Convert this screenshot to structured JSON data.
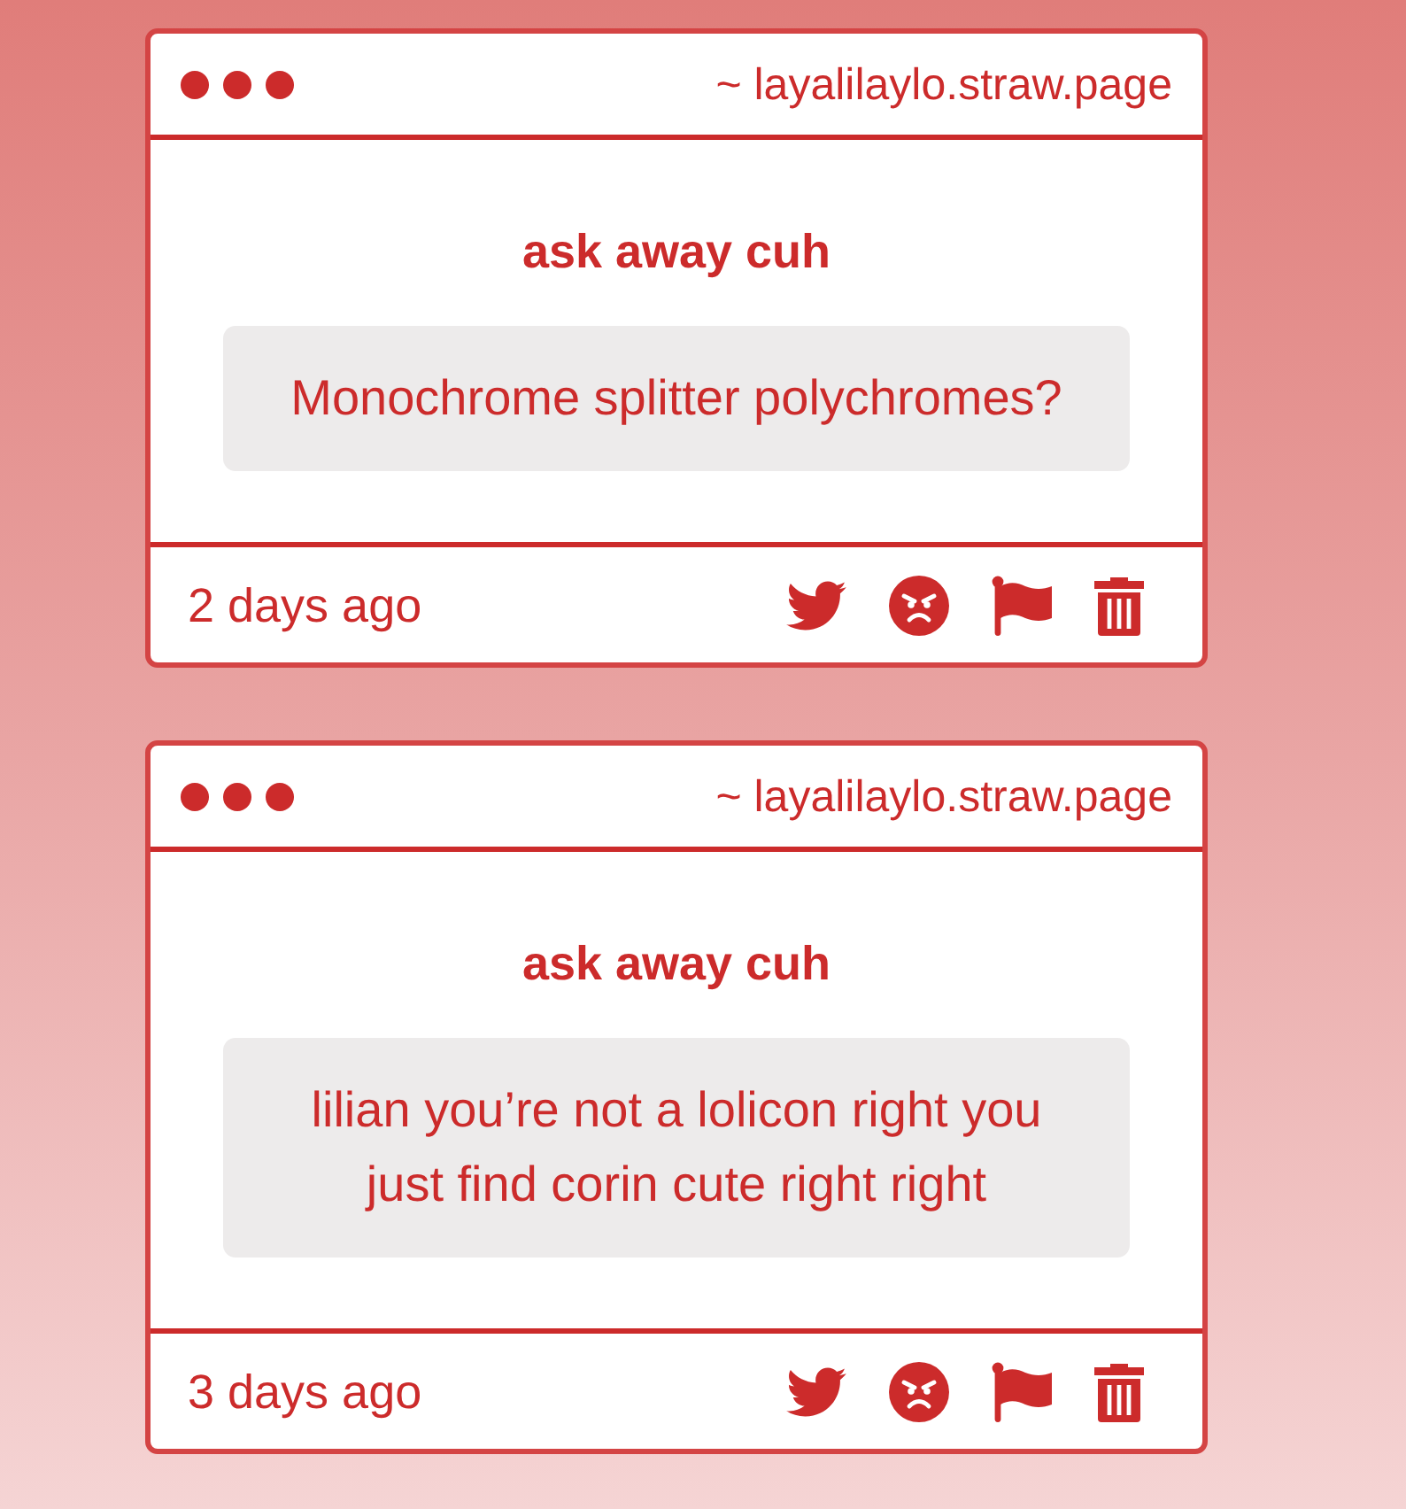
{
  "questions": [
    {
      "site": "~ layalilaylo.straw.page",
      "heading": "ask away cuh",
      "question": "Monochrome splitter polychromes?",
      "time": "2 days ago",
      "actions": [
        {
          "kind": "tweet"
        },
        {
          "kind": "angry"
        },
        {
          "kind": "flag"
        },
        {
          "kind": "delete"
        }
      ]
    },
    {
      "site": "~ layalilaylo.straw.page",
      "heading": "ask away cuh",
      "question": "lilian you’re not a lolicon right you just find corin cute right right",
      "time": "3 days ago",
      "actions": [
        {
          "kind": "tweet"
        },
        {
          "kind": "angry"
        },
        {
          "kind": "flag"
        },
        {
          "kind": "delete"
        }
      ]
    }
  ]
}
